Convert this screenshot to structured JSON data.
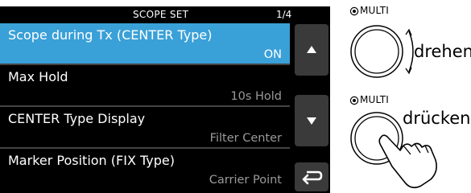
{
  "header": {
    "title": "SCOPE SET",
    "page": "1/4"
  },
  "menu": {
    "items": [
      {
        "label": "Scope during Tx (CENTER Type)",
        "value": "ON"
      },
      {
        "label": "Max Hold",
        "value": "10s Hold"
      },
      {
        "label": "CENTER Type Display",
        "value": "Filter Center"
      },
      {
        "label": "Marker Position (FIX Type)",
        "value": "Carrier Point"
      }
    ]
  },
  "nav": {
    "up_icon": "triangle-up",
    "down_icon": "triangle-down",
    "back_icon": "return-arrow"
  },
  "knob": {
    "top_caption": "MULTI",
    "top_action": "drehen",
    "bottom_caption": "MULTI",
    "bottom_action": "drücken"
  },
  "colors": {
    "selected_row": "#3aa0d8",
    "background": "#000000",
    "value_text": "#9a9a9a",
    "button": "#3a3a3a"
  }
}
